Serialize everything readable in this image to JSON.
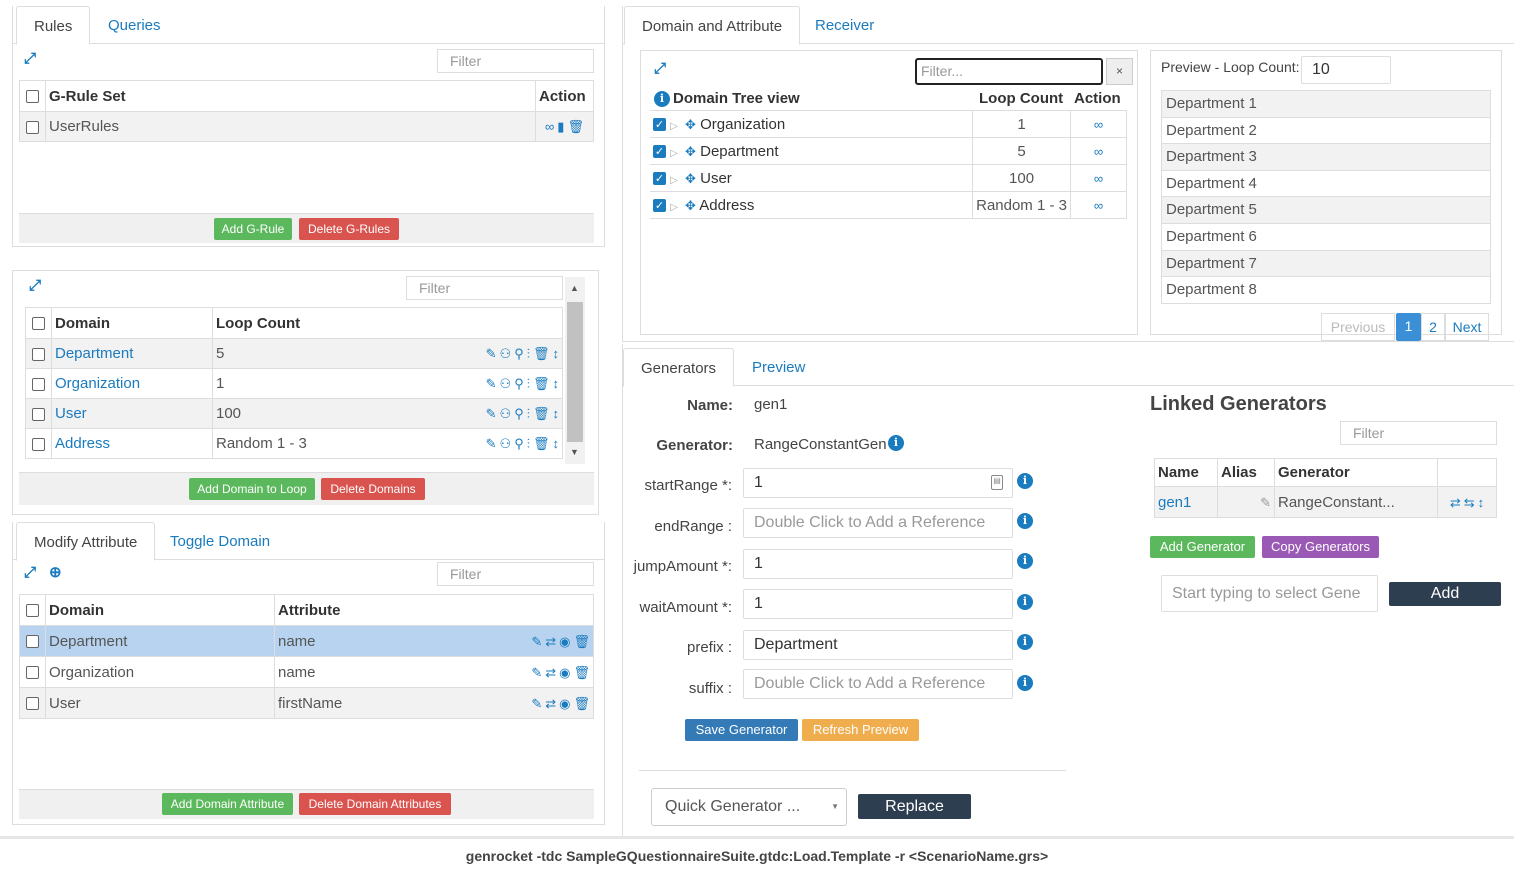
{
  "rules_panel": {
    "tabs": [
      "Rules",
      "Queries"
    ],
    "filter_placeholder": "Filter",
    "headers": {
      "name": "G-Rule Set",
      "action": "Action"
    },
    "rows": [
      {
        "name": "UserRules"
      }
    ],
    "add_button": "Add G-Rule",
    "delete_button": "Delete G-Rules"
  },
  "domain_panel": {
    "filter_placeholder": "Filter",
    "headers": {
      "domain": "Domain",
      "loop": "Loop Count"
    },
    "rows": [
      {
        "domain": "Department",
        "loop": "5"
      },
      {
        "domain": "Organization",
        "loop": "1"
      },
      {
        "domain": "User",
        "loop": "100"
      },
      {
        "domain": "Address",
        "loop": "Random 1 - 3"
      }
    ],
    "add_button": "Add Domain to Loop",
    "delete_button": "Delete Domains"
  },
  "attr_panel": {
    "tabs": [
      "Modify Attribute",
      "Toggle Domain"
    ],
    "filter_placeholder": "Filter",
    "headers": {
      "domain": "Domain",
      "attribute": "Attribute"
    },
    "rows": [
      {
        "domain": "Department",
        "attribute": "name",
        "selected": true
      },
      {
        "domain": "Organization",
        "attribute": "name",
        "selected": false
      },
      {
        "domain": "User",
        "attribute": "firstName",
        "selected": false
      }
    ],
    "add_button": "Add Domain Attribute",
    "delete_button": "Delete Domain Attributes"
  },
  "domain_attr_panel": {
    "tabs": [
      "Domain and Attribute",
      "Receiver"
    ],
    "filter_placeholder": "Filter...",
    "clear_label": "×",
    "tree_title": "Domain Tree view",
    "headers": {
      "loop": "Loop Count",
      "action": "Action"
    },
    "tree_rows": [
      {
        "name": "Organization",
        "loop": "1"
      },
      {
        "name": "Department",
        "loop": "5"
      },
      {
        "name": "User",
        "loop": "100"
      },
      {
        "name": "Address",
        "loop": "Random 1 - 3"
      }
    ],
    "preview_label": "Preview - Loop Count:",
    "preview_count": "10",
    "preview_rows": [
      "Department 1",
      "Department 2",
      "Department 3",
      "Department 4",
      "Department 5",
      "Department 6",
      "Department 7",
      "Department 8"
    ],
    "pager": {
      "previous": "Previous",
      "pages": [
        "1",
        "2"
      ],
      "next": "Next"
    }
  },
  "generators": {
    "tabs": [
      "Generators",
      "Preview"
    ],
    "name_label": "Name:",
    "name_value": "gen1",
    "generator_label": "Generator:",
    "generator_value": "RangeConstantGen",
    "fields": [
      {
        "label": "startRange *:",
        "value": "1",
        "placeholder": ""
      },
      {
        "label": "endRange :",
        "value": "",
        "placeholder": "Double Click to Add a Reference"
      },
      {
        "label": "jumpAmount *:",
        "value": "1",
        "placeholder": ""
      },
      {
        "label": "waitAmount *:",
        "value": "1",
        "placeholder": ""
      },
      {
        "label": "prefix :",
        "value": "Department",
        "placeholder": ""
      },
      {
        "label": "suffix :",
        "value": "",
        "placeholder": "Double Click to Add a Reference"
      }
    ],
    "save_button": "Save Generator",
    "refresh_button": "Refresh Preview",
    "quick_select": "Quick Generator ...",
    "replace_button": "Replace"
  },
  "linked": {
    "title": "Linked Generators",
    "filter_placeholder": "Filter",
    "headers": {
      "name": "Name",
      "alias": "Alias",
      "generator": "Generator"
    },
    "rows": [
      {
        "name": "gen1",
        "alias": "",
        "generator": "RangeConstant..."
      }
    ],
    "add_button": "Add Generator",
    "copy_button": "Copy Generators",
    "select_placeholder": "Start typing to select Gene",
    "add_label": "Add"
  },
  "command_line": "genrocket -tdc SampleGQuestionnaireSuite.gtdc:Load.Template -r <ScenarioName.grs>"
}
